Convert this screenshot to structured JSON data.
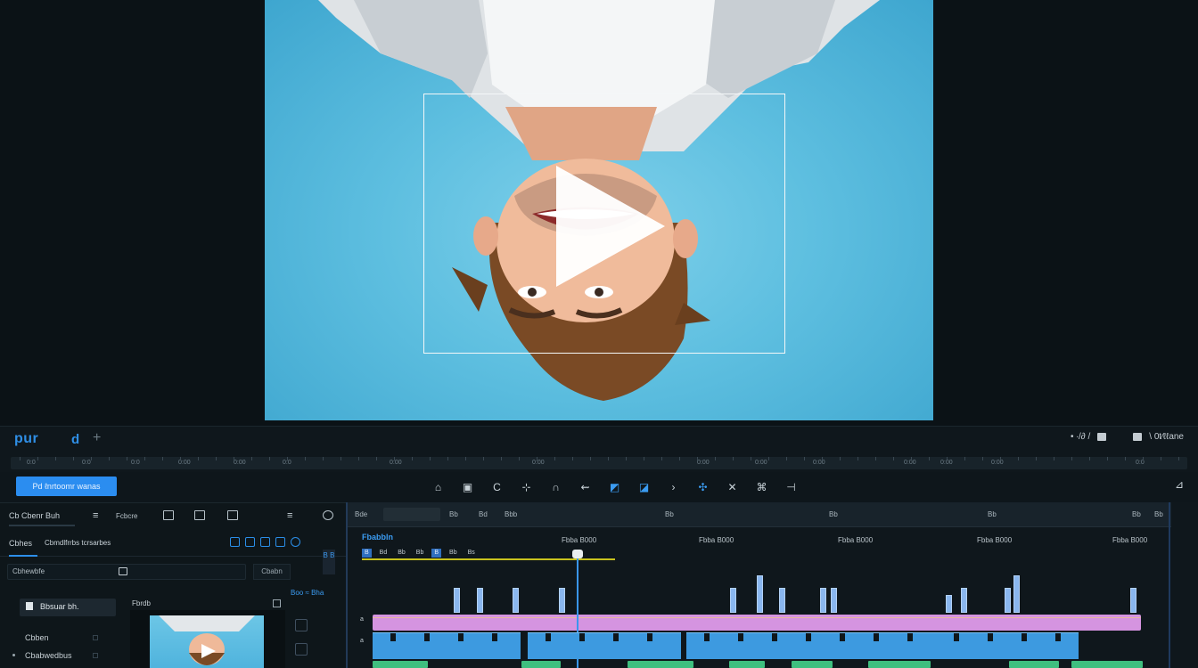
{
  "ruler": {
    "brand": "pur",
    "brand_ext": "d",
    "plus": "+",
    "right_label": "• ∙/∂ /",
    "right_label2": "\\ 0t∕ℓℓane",
    "ticks": [
      "0:0",
      "0:0",
      "0:0",
      "0:00",
      "0:00",
      "0:0",
      "0:00",
      "0:00",
      "0:00",
      "0:00",
      "0:00",
      "0:00",
      "0:00",
      "0:00",
      "0:0"
    ]
  },
  "toolbar": {
    "export_label": "Pd ℓnrtoomr wanas",
    "tools": [
      "⌂",
      "▣",
      "C",
      "⊹",
      "∩",
      "⇜",
      "◩",
      "◪",
      "›",
      "✣",
      "✕",
      "⌘",
      "⊣"
    ],
    "end_icon": "⊿"
  },
  "left_panel": {
    "title": "Cb Cbenr Buh",
    "menu_label": "Fcbcre",
    "tabs": [
      "Cbhes",
      "Cbmdlfrrbs  tcrsarbes"
    ],
    "search_placeholder": "Cbhewbfe",
    "search_button": "Cbabn",
    "side_num": "B\nB",
    "blue_link": "Boo ≈ Bha",
    "folder_button": "Bbsuar bh.",
    "items": [
      "Cbben",
      "Cbabwedbus"
    ],
    "media_label": "Fbrdb"
  },
  "timeline": {
    "head_labels": [
      "Bde",
      "Bb",
      "Bd",
      "Bbb",
      "Bb",
      "Bb",
      "Bb",
      "Bb",
      "Bb"
    ],
    "title": "Fbabbln",
    "time_labels": [
      "Fbba B000",
      "Fbba B000",
      "Fbba B000",
      "Fbba B000",
      "Fbba B000"
    ],
    "chips": [
      "B",
      "Bd",
      "Bb",
      "Bb",
      "B",
      "Bb",
      "Bs"
    ],
    "track_labels": [
      "a",
      "a"
    ]
  },
  "colors": {
    "accent": "#2b8df0",
    "sky": "#5ebfe0",
    "purple_track": "#d594e0",
    "blue_track": "#3d9ae0",
    "green_track": "#3fbf7f"
  }
}
